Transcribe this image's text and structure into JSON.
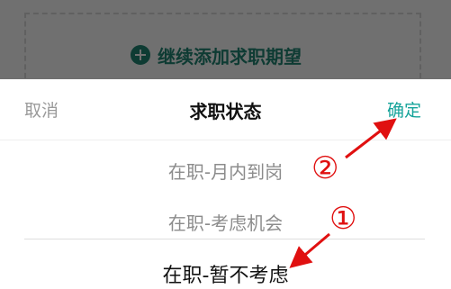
{
  "background": {
    "add_button_label": "继续添加求职期望"
  },
  "sheet": {
    "cancel_label": "取消",
    "title": "求职状态",
    "confirm_label": "确定",
    "options": [
      {
        "label": "在职-月内到岗"
      },
      {
        "label": "在职-考虑机会"
      },
      {
        "label": "在职-暂不考虑"
      }
    ],
    "selected_option": "在职-暂不考虑"
  },
  "annotations": {
    "marker_1": "①",
    "marker_2": "②",
    "color": "#e01010"
  }
}
